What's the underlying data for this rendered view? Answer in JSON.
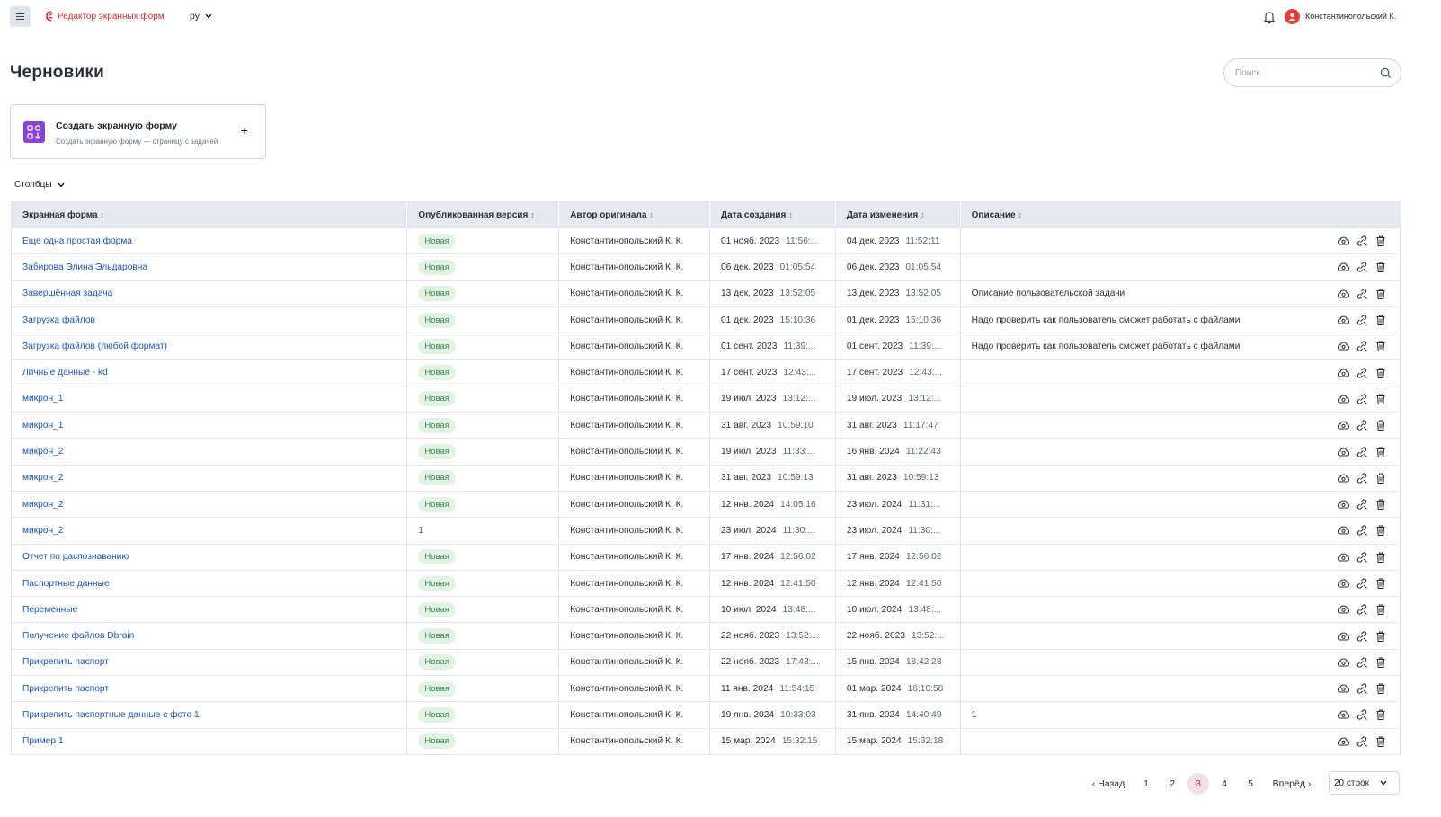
{
  "header": {
    "app_name": "Редактор экранных форм",
    "language": "ру",
    "user_name": "Константинопольский К."
  },
  "page": {
    "title": "Черновики",
    "search_placeholder": "Поиск",
    "columns_toggle": "Столбцы"
  },
  "create_card": {
    "title": "Создать экранную форму",
    "subtitle": "Создать экранную форму — страницу с задачей",
    "plus": "+"
  },
  "table": {
    "headers": [
      "Экранная форма",
      "Опубликованная версия",
      "Автор оригинала",
      "Дата создания",
      "Дата изменения",
      "Описание"
    ],
    "sort_icon": "↕",
    "rows": [
      {
        "name": "Еще одна простая форма",
        "version": "Новая",
        "author": "Константинопольский К. К.",
        "created_date": "01 нояб. 2023",
        "created_time": "11:56:...",
        "modified_date": "04 дек. 2023",
        "modified_time": "11:52:11",
        "description": ""
      },
      {
        "name": "Забирова Элина Эльдаровна",
        "version": "Новая",
        "author": "Константинопольский К. К.",
        "created_date": "06 дек. 2023",
        "created_time": "01:05:54",
        "modified_date": "06 дек. 2023",
        "modified_time": "01:05:54",
        "description": ""
      },
      {
        "name": "Завершённая задача",
        "version": "Новая",
        "author": "Константинопольский К. К.",
        "created_date": "13 дек. 2023",
        "created_time": "13:52:05",
        "modified_date": "13 дек. 2023",
        "modified_time": "13:52:05",
        "description": "Описание пользовательской задачи"
      },
      {
        "name": "Загрузка файлов",
        "version": "Новая",
        "author": "Константинопольский К. К.",
        "created_date": "01 дек. 2023",
        "created_time": "15:10:36",
        "modified_date": "01 дек. 2023",
        "modified_time": "15:10:36",
        "description": "Надо проверить как пользователь сможет работать с файлами"
      },
      {
        "name": "Загрузка файлов (любой формат)",
        "version": "Новая",
        "author": "Константинопольский К. К.",
        "created_date": "01 сент. 2023",
        "created_time": "11:39:...",
        "modified_date": "01 сент. 2023",
        "modified_time": "11:39:...",
        "description": "Надо проверить как пользователь сможет работать с файлами"
      },
      {
        "name": "Личные данные - kd",
        "version": "Новая",
        "author": "Константинопольский К. К.",
        "created_date": "17 сент. 2023",
        "created_time": "12:43:...",
        "modified_date": "17 сент. 2023",
        "modified_time": "12:43:...",
        "description": ""
      },
      {
        "name": "микрон_1",
        "version": "Новая",
        "author": "Константинопольский К. К.",
        "created_date": "19 июл. 2023",
        "created_time": "13:12:...",
        "modified_date": "19 июл. 2023",
        "modified_time": "13:12:...",
        "description": ""
      },
      {
        "name": "микрон_1",
        "version": "Новая",
        "author": "Константинопольский К. К.",
        "created_date": "31 авг. 2023",
        "created_time": "10:59:10",
        "modified_date": "31 авг. 2023",
        "modified_time": "11:17:47",
        "description": ""
      },
      {
        "name": "микрон_2",
        "version": "Новая",
        "author": "Константинопольский К. К.",
        "created_date": "19 июл. 2023",
        "created_time": "11:33:...",
        "modified_date": "16 янв. 2024",
        "modified_time": "11:22:43",
        "description": ""
      },
      {
        "name": "микрон_2",
        "version": "Новая",
        "author": "Константинопольский К. К.",
        "created_date": "31 авг. 2023",
        "created_time": "10:59:13",
        "modified_date": "31 авг. 2023",
        "modified_time": "10:59:13",
        "description": ""
      },
      {
        "name": "микрон_2",
        "version": "Новая",
        "author": "Константинопольский К. К.",
        "created_date": "12 янв. 2024",
        "created_time": "14:05:16",
        "modified_date": "23 июл. 2024",
        "modified_time": "11:31:...",
        "description": ""
      },
      {
        "name": "микрон_2",
        "version": "1",
        "author": "Константинопольский К. К.",
        "created_date": "23 июл. 2024",
        "created_time": "11:30:...",
        "modified_date": "23 июл. 2024",
        "modified_time": "11:30:...",
        "description": ""
      },
      {
        "name": "Отчет по распознаванию",
        "version": "Новая",
        "author": "Константинопольский К. К.",
        "created_date": "17 янв. 2024",
        "created_time": "12:56:02",
        "modified_date": "17 янв. 2024",
        "modified_time": "12:56:02",
        "description": ""
      },
      {
        "name": "Паспортные данные",
        "version": "Новая",
        "author": "Константинопольский К. К.",
        "created_date": "12 янв. 2024",
        "created_time": "12:41:50",
        "modified_date": "12 янв. 2024",
        "modified_time": "12:41:50",
        "description": ""
      },
      {
        "name": "Переменные",
        "version": "Новая",
        "author": "Константинопольский К. К.",
        "created_date": "10 июл. 2024",
        "created_time": "13:48:...",
        "modified_date": "10 июл. 2024",
        "modified_time": "13:48:...",
        "description": ""
      },
      {
        "name": "Получение файлов Dbrain",
        "version": "Новая",
        "author": "Константинопольский К. К.",
        "created_date": "22 нояб. 2023",
        "created_time": "13:52:...",
        "modified_date": "22 нояб. 2023",
        "modified_time": "13:52:...",
        "description": ""
      },
      {
        "name": "Прикрепить паспорт",
        "version": "Новая",
        "author": "Константинопольский К. К.",
        "created_date": "22 нояб. 2023",
        "created_time": "17:43:...",
        "modified_date": "15 янв. 2024",
        "modified_time": "18:42:28",
        "description": ""
      },
      {
        "name": "Прикрепить паспорт",
        "version": "Новая",
        "author": "Константинопольский К. К.",
        "created_date": "11 янв. 2024",
        "created_time": "11:54:15",
        "modified_date": "01 мар. 2024",
        "modified_time": "16:10:58",
        "description": ""
      },
      {
        "name": "Прикрепить паспортные данные с фото 1",
        "version": "Новая",
        "author": "Константинопольский К. К.",
        "created_date": "19 янв. 2024",
        "created_time": "10:33:03",
        "modified_date": "31 янв. 2024",
        "modified_time": "14:40:49",
        "description": "1"
      },
      {
        "name": "Пример 1",
        "version": "Новая",
        "author": "Константинопольский К. К.",
        "created_date": "15 мар. 2024",
        "created_time": "15:32:15",
        "modified_date": "15 мар. 2024",
        "modified_time": "15:32:18",
        "description": ""
      }
    ],
    "row_actions": [
      "publish-cloud-icon",
      "copy-link-icon",
      "trash-icon"
    ]
  },
  "pagination": {
    "prev": "‹ Назад",
    "pages": [
      "1",
      "2",
      "3",
      "4",
      "5"
    ],
    "current": "3",
    "next": "Вперёд ›",
    "rows_per_page": "20 строк"
  },
  "colors": {
    "brand_red": "#d52b2b",
    "link_blue": "#1a56b8",
    "badge_green_bg": "#e2f3e5",
    "badge_green_text": "#3a8a4e",
    "header_bg": "#e6eaf0",
    "create_icon_purple": "#8a42d6"
  }
}
